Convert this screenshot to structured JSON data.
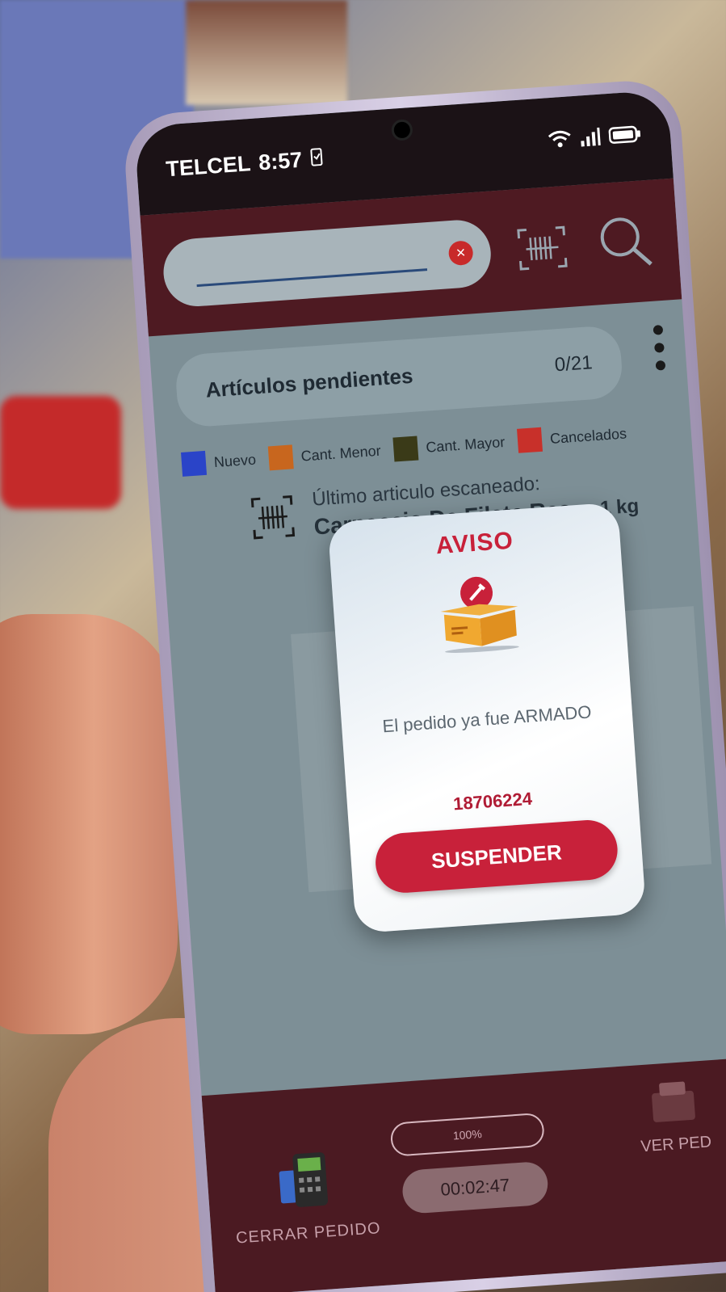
{
  "status_bar": {
    "carrier": "TELCEL",
    "time": "8:57"
  },
  "search": {
    "value": "",
    "placeholder": ""
  },
  "pending": {
    "title": "Artículos pendientes",
    "count": "0/21"
  },
  "legend": [
    {
      "label": "Nuevo",
      "color": "#2a44c8"
    },
    {
      "label": "Cant. Menor",
      "color": "#c8661e"
    },
    {
      "label": "Cant. Mayor",
      "color": "#3a3a18"
    },
    {
      "label": "Cancelados",
      "color": "#c8302a"
    }
  ],
  "last_scanned": {
    "label": "Último articulo escaneado:",
    "name": "Carpaccio De Filete,Res",
    "quantity": "1 kg"
  },
  "modal": {
    "title": "AVISO",
    "message": "El pedido ya fue ARMADO",
    "order_number": "18706224",
    "button_label": "SUSPENDER"
  },
  "bottom_bar": {
    "progress_label": "100%",
    "progress": 1.0,
    "timer": "00:02:47",
    "close_order_label": "CERRAR PEDIDO",
    "view_order_label": "VER PED"
  },
  "colors": {
    "accent": "#c8213a",
    "header_bg": "#4e1a22"
  }
}
